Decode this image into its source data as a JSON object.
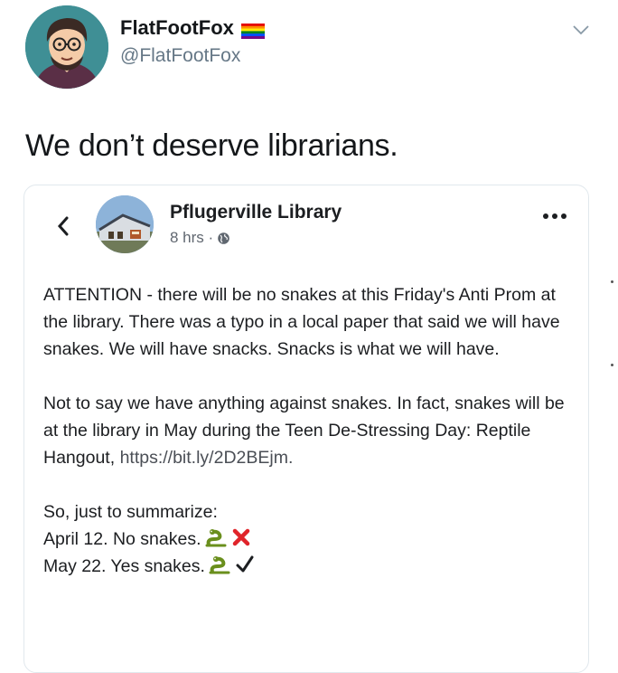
{
  "tweet": {
    "display_name": "FlatFootFox",
    "handle": "@FlatFootFox",
    "text": "We don’t deserve librarians."
  },
  "icons": {
    "avatar": "cartoon-avatar",
    "flag": "rainbow-pride-flag-icon",
    "menu": "chevron-down-icon"
  },
  "embedded_post": {
    "page_name": "Pflugerville Library",
    "time": "8 hrs ·",
    "paragraph1": "ATTENTION - there will be no snakes at this Friday's Anti Prom at the library. There was a typo in a local paper that said we will have snakes. We will have snacks. Snacks is what we will have.",
    "paragraph2_text": "Not to say we have anything against snakes. In fact, snakes will be at the library in May during the Teen De-Stressing Day: Reptile Hangout, ",
    "paragraph2_link": "https://bit.ly/2D2BEjm.",
    "summary_intro": "So, just to summarize:",
    "line_no": "April 12. No snakes.",
    "line_yes": "May 22. Yes snakes."
  },
  "colors": {
    "text": "#14171a",
    "secondary": "#657786",
    "cross": "#e0242a",
    "check": "#1c1e21"
  }
}
